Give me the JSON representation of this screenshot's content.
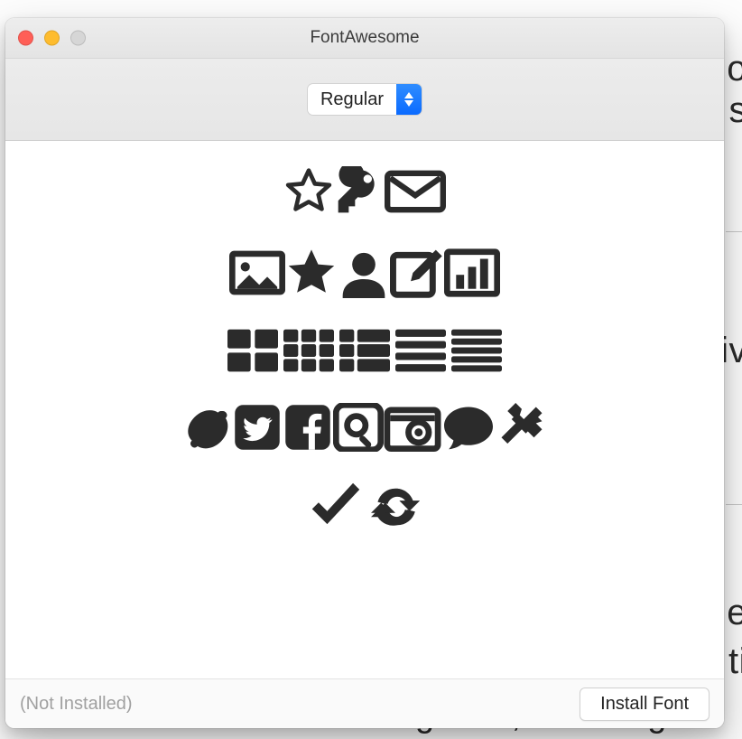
{
  "window": {
    "title": "FontAwesome",
    "style_selected": "Regular",
    "status": "(Not Installed)",
    "install_label": "Install Font"
  },
  "preview_rows": [
    [
      "star-outline",
      "key",
      "envelope"
    ],
    [
      "picture",
      "star-solid",
      "user",
      "edit-square",
      "bar-chart"
    ],
    [
      "th-large",
      "th",
      "th-list",
      "list-lines",
      "list-justified"
    ],
    [
      "lemon",
      "twitter-square",
      "facebook-square",
      "search-square",
      "camera-square",
      "comment",
      "tools"
    ],
    [
      "check",
      "refresh"
    ]
  ],
  "background_fragments": {
    "t1": "o",
    "t2": "s",
    "t3": "iv",
    "t4": "e",
    "t5": "ti",
    "bottom": "was an amazing idea, but things"
  }
}
